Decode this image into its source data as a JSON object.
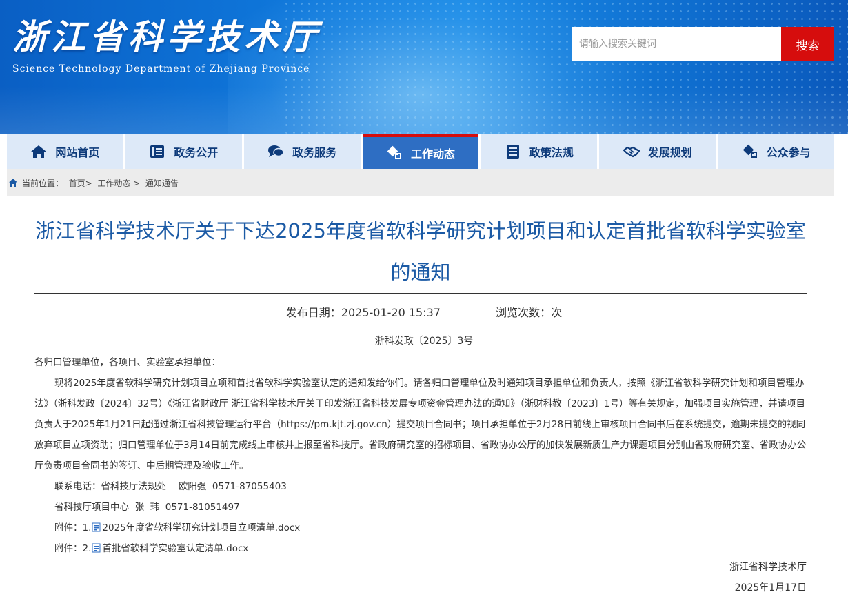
{
  "header": {
    "logo_cn": "浙江省科学技术厅",
    "logo_en": "Science Technology Department of Zhejiang Province",
    "search_placeholder": "请输入搜索关键词",
    "search_button": "搜索"
  },
  "nav": {
    "items": [
      {
        "label": "网站首页",
        "icon": "home-icon"
      },
      {
        "label": "政务公开",
        "icon": "document-list-icon"
      },
      {
        "label": "政务服务",
        "icon": "chat-bubbles-icon"
      },
      {
        "label": "工作动态",
        "icon": "diamond-chart-icon",
        "active": true
      },
      {
        "label": "政策法规",
        "icon": "list-icon"
      },
      {
        "label": "发展规划",
        "icon": "handshake-icon"
      },
      {
        "label": "公众参与",
        "icon": "diamond-chart-icon"
      }
    ]
  },
  "breadcrumb": {
    "prefix": "当前位置：",
    "items": [
      "首页>",
      "工作动态 >",
      "通知通告"
    ]
  },
  "article": {
    "title": "浙江省科学技术厅关于下达2025年度省软科学研究计划项目和认定首批省软科学实验室的通知",
    "date_label": "发布日期：",
    "date_value": "2025-01-20 15:37",
    "views_label": "浏览次数：",
    "views_value": "次",
    "doc_no": "浙科发政〔2025〕3号",
    "salutation": "各归口管理单位，各项目、实验室承担单位：",
    "body": "现将2025年度省软科学研究计划项目立项和首批省软科学实验室认定的通知发给你们。请各归口管理单位及时通知项目承担单位和负责人，按照《浙江省软科学研究计划和项目管理办法》（浙科发政〔2024〕32号）《浙江省财政厅 浙江省科学技术厅关于印发浙江省科技发展专项资金管理办法的通知》（浙财科教〔2023〕1号）等有关规定，加强项目实施管理，并请项目负责人于2025年1月21日起通过浙江省科技管理运行平台（https://pm.kjt.zj.gov.cn）提交项目合同书；项目承担单位于2月28日前线上审核项目合同书后在系统提交，逾期未提交的视同放弃项目立项资助；归口管理单位于3月14日前完成线上审核并上报至省科技厅。省政府研究室的招标项目、省政协办公厅的加快发展新质生产力课题项目分别由省政府研究室、省政协办公厅负责项目合同书的签订、中后期管理及验收工作。",
    "contact1": "联系电话：省科技厅法规处　 欧阳强  0571-87055403",
    "contact2": "省科技厅项目中心  张  玮  0571-81051497",
    "attachments": [
      {
        "prefix": "附件：1.",
        "name": "2025年度省软科学研究计划项目立项清单.docx"
      },
      {
        "prefix": "附件：2.",
        "name": "首批省软科学实验室认定清单.docx"
      }
    ],
    "signer": "浙江省科学技术厅",
    "sign_date": "2025年1月17日"
  },
  "colors": {
    "brand_blue": "#1b5aa5",
    "nav_active": "#2e6ec3",
    "accent_red": "#d60d0d",
    "nav_bg": "#dde9f8"
  }
}
